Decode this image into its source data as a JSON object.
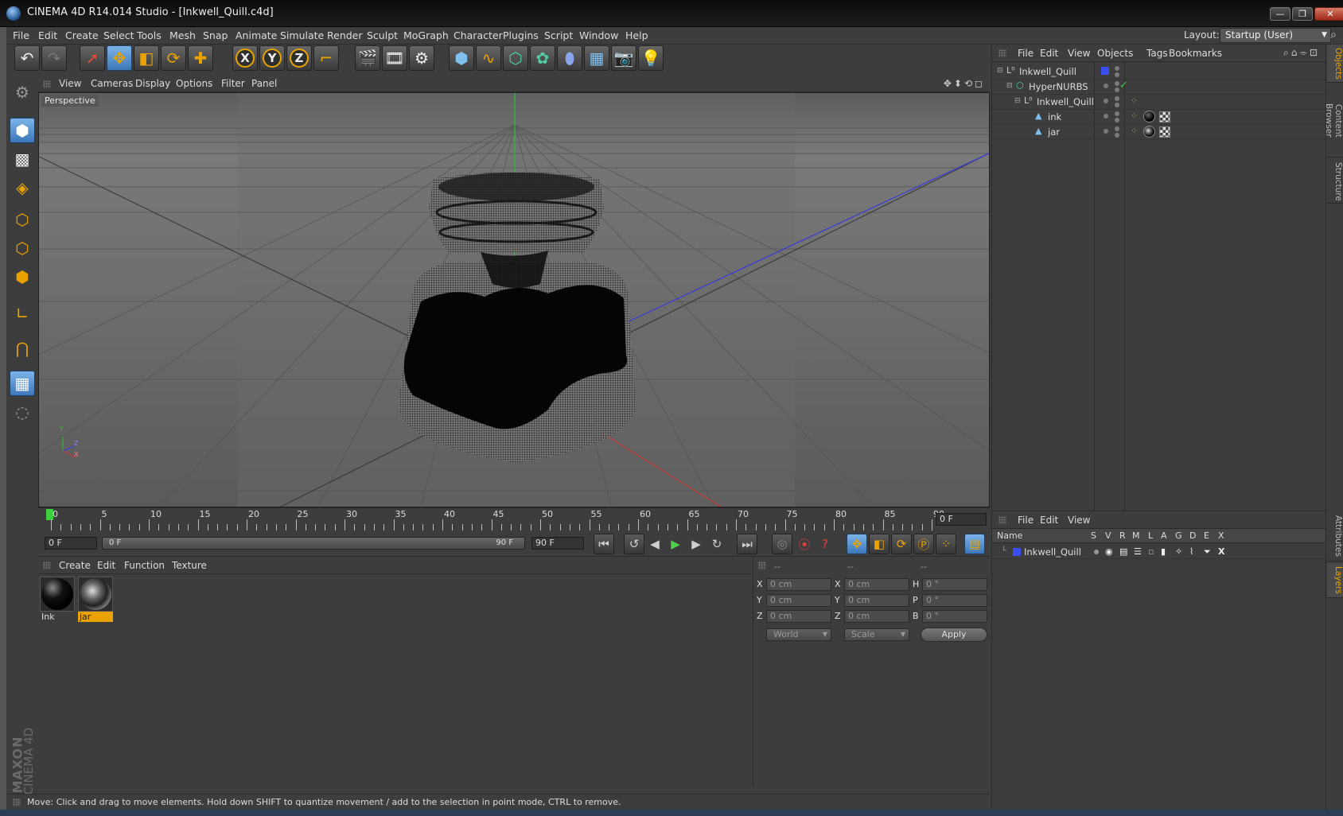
{
  "window": {
    "title": "CINEMA 4D R14.014 Studio - [Inkwell_Quill.c4d]",
    "minimize": "—",
    "restore": "❐",
    "close": "✕"
  },
  "menubar": {
    "items": [
      "File",
      "Edit",
      "Create",
      "Select",
      "Tools",
      "Mesh",
      "Snap",
      "Animate",
      "Simulate",
      "Render",
      "Sculpt",
      "MoGraph",
      "Character",
      "Plugins",
      "Script",
      "Window",
      "Help"
    ],
    "layout_label": "Layout:",
    "layout_value": "Startup (User)"
  },
  "viewport": {
    "menu": [
      "View",
      "Cameras",
      "Display",
      "Options",
      "Filter",
      "Panel"
    ],
    "label": "Perspective",
    "axis_y": "Y",
    "axis_z": "Z",
    "axis_x": "X"
  },
  "timeline": {
    "ticks": [
      "0",
      "5",
      "10",
      "15",
      "20",
      "25",
      "30",
      "35",
      "40",
      "45",
      "50",
      "55",
      "60",
      "65",
      "70",
      "75",
      "80",
      "85",
      "90"
    ],
    "current_frame": "0 F",
    "start_field": "0 F",
    "slider_start": "0 F",
    "slider_end": "90 F",
    "end_field": "90 F"
  },
  "material_manager": {
    "menu": [
      "Create",
      "Edit",
      "Function",
      "Texture"
    ],
    "materials": [
      {
        "name": "Ink",
        "selected": false
      },
      {
        "name": "jar",
        "selected": true
      }
    ]
  },
  "coordinates": {
    "headers": [
      "--",
      "--",
      "--"
    ],
    "rows": [
      {
        "l1": "X",
        "v1": "0 cm",
        "l2": "X",
        "v2": "0 cm",
        "l3": "H",
        "v3": "0 °"
      },
      {
        "l1": "Y",
        "v1": "0 cm",
        "l2": "Y",
        "v2": "0 cm",
        "l3": "P",
        "v3": "0 °"
      },
      {
        "l1": "Z",
        "v1": "0 cm",
        "l2": "Z",
        "v2": "0 cm",
        "l3": "B",
        "v3": "0 °"
      }
    ],
    "space": "World",
    "mode": "Scale",
    "apply": "Apply"
  },
  "object_manager": {
    "menu": [
      "File",
      "Edit",
      "View",
      "Objects",
      "Tags",
      "Bookmarks"
    ],
    "objects": [
      {
        "name": "Inkwell_Quill",
        "indent": 0
      },
      {
        "name": "HyperNURBS",
        "indent": 1
      },
      {
        "name": "Inkwell_Quill",
        "indent": 2
      },
      {
        "name": "ink",
        "indent": 3
      },
      {
        "name": "jar",
        "indent": 3
      }
    ]
  },
  "layer_manager": {
    "menu": [
      "File",
      "Edit",
      "View"
    ],
    "columns": [
      "Name",
      "S",
      "V",
      "R",
      "M",
      "L",
      "A",
      "G",
      "D",
      "E",
      "X"
    ],
    "layers": [
      {
        "name": "Inkwell_Quill"
      }
    ]
  },
  "side_tabs": [
    "Objects",
    "Content Browser",
    "Structure",
    "Attributes",
    "Layers"
  ],
  "status": {
    "text": "Move: Click and drag to move elements. Hold down SHIFT to quantize movement / add to the selection in point mode, CTRL to remove."
  },
  "brand": {
    "line1": "MAXON",
    "line2": "CINEMA 4D"
  },
  "colors": {
    "accent": "#e9a300",
    "selection": "#5b93cf",
    "background": "#3d3d3d"
  }
}
